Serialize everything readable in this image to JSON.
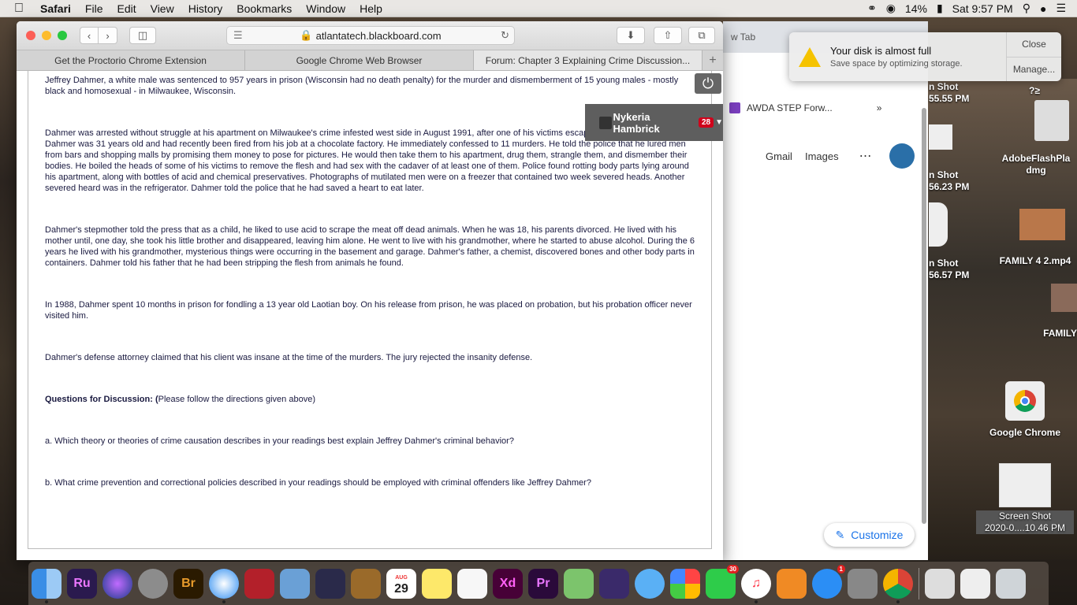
{
  "menubar": {
    "app": "Safari",
    "items": [
      "File",
      "Edit",
      "View",
      "History",
      "Bookmarks",
      "Window",
      "Help"
    ],
    "battery": "14%",
    "clock": "Sat 9:57 PM"
  },
  "safari": {
    "url": "atlantatech.blackboard.com",
    "tabs": [
      "Get the Proctorio Chrome Extension",
      "Google Chrome Web Browser",
      "Forum: Chapter 3 Explaining Crime Discussion..."
    ],
    "proctor_name": "Nykeria Hambrick",
    "proctor_badge": "28"
  },
  "content": {
    "p1": "Jeffrey Dahmer, a white male was sentenced to 957 years in prison (Wisconsin had no death penalty) for the murder and dismemberment of 15 young males - mostly black and homosexual - in Milwaukee, Wisconsin.",
    "p2": "Dahmer was arrested without struggle at his apartment on Milwaukee's crime infested west side in August 1991, after one of his victims escaped and notified the police.  Dahmer was 31 years old and had recently been fired from his job at a chocolate factory.  He immediately confessed to 11 murders.  He told the police that he lured men from bars and shopping malls by promising them money to pose for pictures.  He would then take them to his apartment, drug them, strangle them, and dismember their bodies.  He boiled the heads of some of his victims to remove the flesh and had sex with the cadaver of at least one of them.  Police found rotting body parts lying around his apartment, along with bottles of acid and chemical preservatives.  Photographs of mutilated men were on a freezer that contained two week severed heads.  Another severed heard was in the refrigerator.  Dahmer told the police that he had saved a heart to eat later.",
    "p3": "Dahmer's stepmother told the press that as a child, he liked to use acid to scrape the meat off dead animals.  When he was 18, his parents divorced.  He lived with his mother until, one day, she took his little brother and disappeared, leaving him alone.  He went to live with his grandmother, where he started to abuse alcohol.  During the 6 years he lived with his grandmother, mysterious things were occurring in the basement and garage.  Dahmer's father, a chemist, discovered bones and other body parts in containers.  Dahmer told his father that he had been stripping the flesh from animals he found.",
    "p4": "In 1988, Dahmer spent 10 months in prison for fondling a 13 year old Laotian boy.  On his release from prison, he was placed on probation, but his probation officer never visited him.",
    "p5": "Dahmer's defense attorney claimed that his client was insane at the time of the murders.  The jury rejected the insanity defense.",
    "q_heading": "Questions for Discussion: (",
    "q_heading_rest": "Please follow the directions given above)",
    "qa": "a. Which theory or theories of crime causation describes in your readings best explain Jeffrey Dahmer's criminal behavior?",
    "qb": "b. What crime prevention and correctional policies described in your readings should be employed with criminal offenders like Jeffrey Dahmer?"
  },
  "chrome": {
    "tab": "w Tab",
    "bookmark": "AWDA STEP Forw...",
    "gmail": "Gmail",
    "images": "Images",
    "customize": "Customize"
  },
  "notification": {
    "title": "Your disk is almost full",
    "body": "Save space by optimizing storage.",
    "close": "Close",
    "manage": "Manage..."
  },
  "desktop": {
    "shot1": "n Shot",
    "shot1_time": "55.55 PM",
    "shot2": "n Shot",
    "shot2_time": "56.23 PM",
    "shot3": "n Shot",
    "shot3_time": "56.57 PM",
    "q_label": "?≥",
    "flash": "AdobeFlashPla",
    "flash2": "dmg",
    "family4": "FAMILY 4 2.mp4",
    "family": "FAMILY",
    "gchrome": "Google Chrome",
    "screenshot": "Screen Shot",
    "screenshot2": "2020-0....10.46 PM"
  },
  "dock": {
    "calendar_month": "AUG",
    "calendar_day": "29",
    "facetime_badge": "30",
    "appstore_badge": "1",
    "ru": "Ru",
    "br": "Br",
    "xd": "Xd",
    "pr": "Pr"
  }
}
